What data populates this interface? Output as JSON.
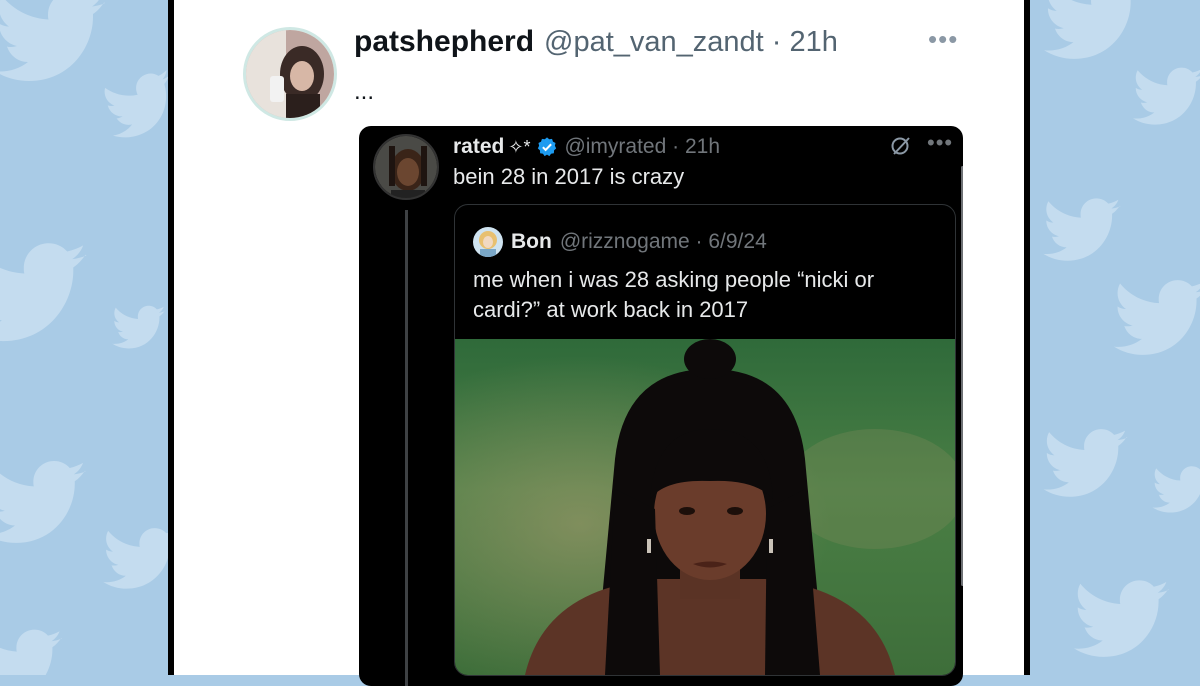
{
  "tweet": {
    "display_name": "patshepherd",
    "handle_time": "@pat_van_zandt · 21h",
    "more_icon": "more-dots-icon",
    "body": "..."
  },
  "quoted": {
    "display_name": "rated",
    "name_decoration": "✧*",
    "verified_icon": "verified-badge-icon",
    "handle_time": "@imyrated · 21h",
    "text": "bein 28 in 2017 is crazy",
    "nested": {
      "display_name": "Bon",
      "handle_time": "@rizznogame · 6/9/24",
      "text": "me when i was 28 asking people “nicki or cardi?” at work back in 2017"
    }
  },
  "colors": {
    "page_background": "#a9cbe6",
    "twitter_blue": "#1d9bf0",
    "dark_card": "#000000"
  }
}
